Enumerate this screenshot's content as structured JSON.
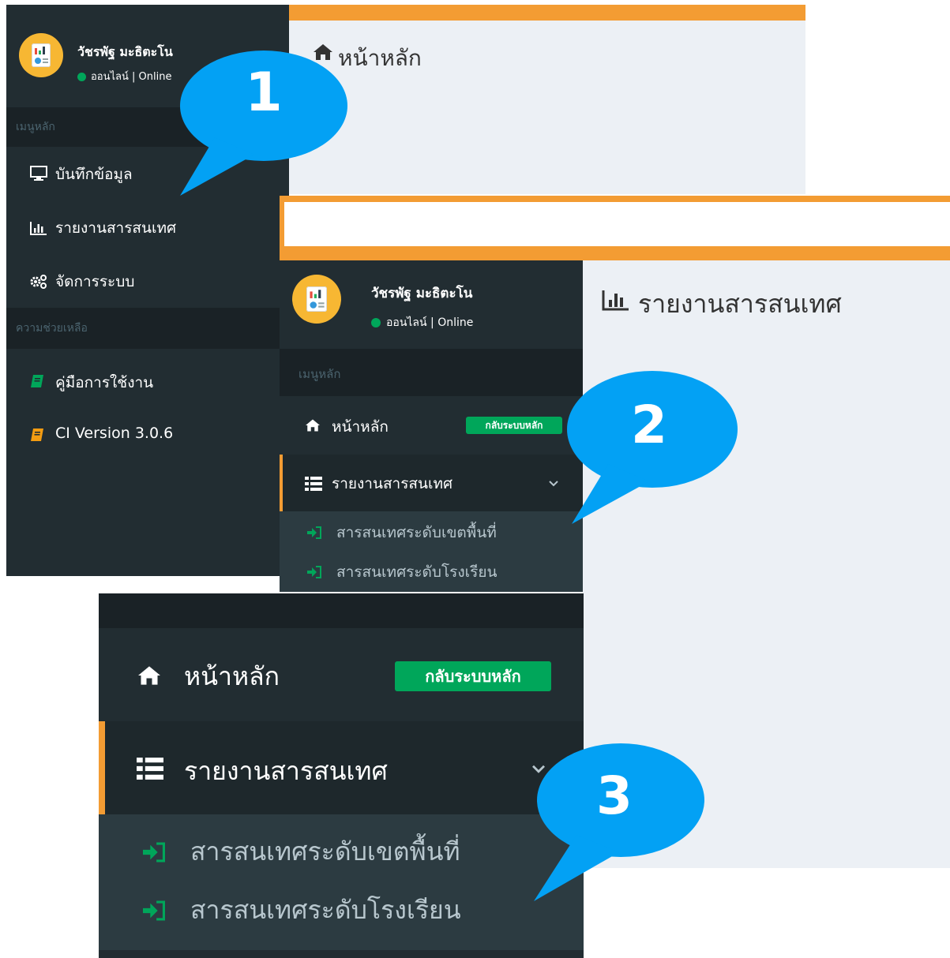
{
  "panel1": {
    "user": {
      "name": "วัชรพัฐ มะธิตะโน",
      "status": "ออนไลน์ | Online"
    },
    "page_title": "หน้าหลัก",
    "section_main": "เมนูหลัก",
    "menu": [
      {
        "label": "บันทึกข้อมูล",
        "icon": "monitor-icon"
      },
      {
        "label": "รายงานสารสนเทศ",
        "icon": "bar-chart-icon"
      },
      {
        "label": "จัดการระบบ",
        "icon": "gears-icon"
      }
    ],
    "section_help": "ความช่วยเหลือ",
    "help": [
      {
        "label": "คู่มือการใช้งาน",
        "icon": "book-icon",
        "color": "#00a65a"
      },
      {
        "label": "CI Version 3.0.6",
        "icon": "book-icon",
        "color": "#f39c12"
      }
    ]
  },
  "panel2": {
    "user": {
      "name": "วัชรพัฐ มะธิตะโน",
      "status": "ออนไลน์ | Online"
    },
    "page_title": "รายงานสารสนเทศ",
    "section_main": "เมนูหลัก",
    "home_label": "หน้าหลัก",
    "home_badge": "กลับระบบหลัก",
    "active_label": "รายงานสารสนเทศ",
    "submenu": [
      {
        "label": "สารสนเทศระดับเขตพื้นที่"
      },
      {
        "label": "สารสนเทศระดับโรงเรียน"
      }
    ]
  },
  "panel3": {
    "home_label": "หน้าหลัก",
    "home_badge": "กลับระบบหลัก",
    "active_label": "รายงานสารสนเทศ",
    "submenu": [
      {
        "label": "สารสนเทศระดับเขตพื้นที่"
      },
      {
        "label": "สารสนเทศระดับโรงเรียน"
      }
    ]
  },
  "callouts": [
    "1",
    "2",
    "3"
  ],
  "colors": {
    "sidebar": "#222d32",
    "sidebar_dark": "#1a2226",
    "accent_orange": "#f39c33",
    "badge_green": "#00a65a",
    "bubble_blue": "#03a1f4",
    "content_bg": "#ecf0f5"
  }
}
